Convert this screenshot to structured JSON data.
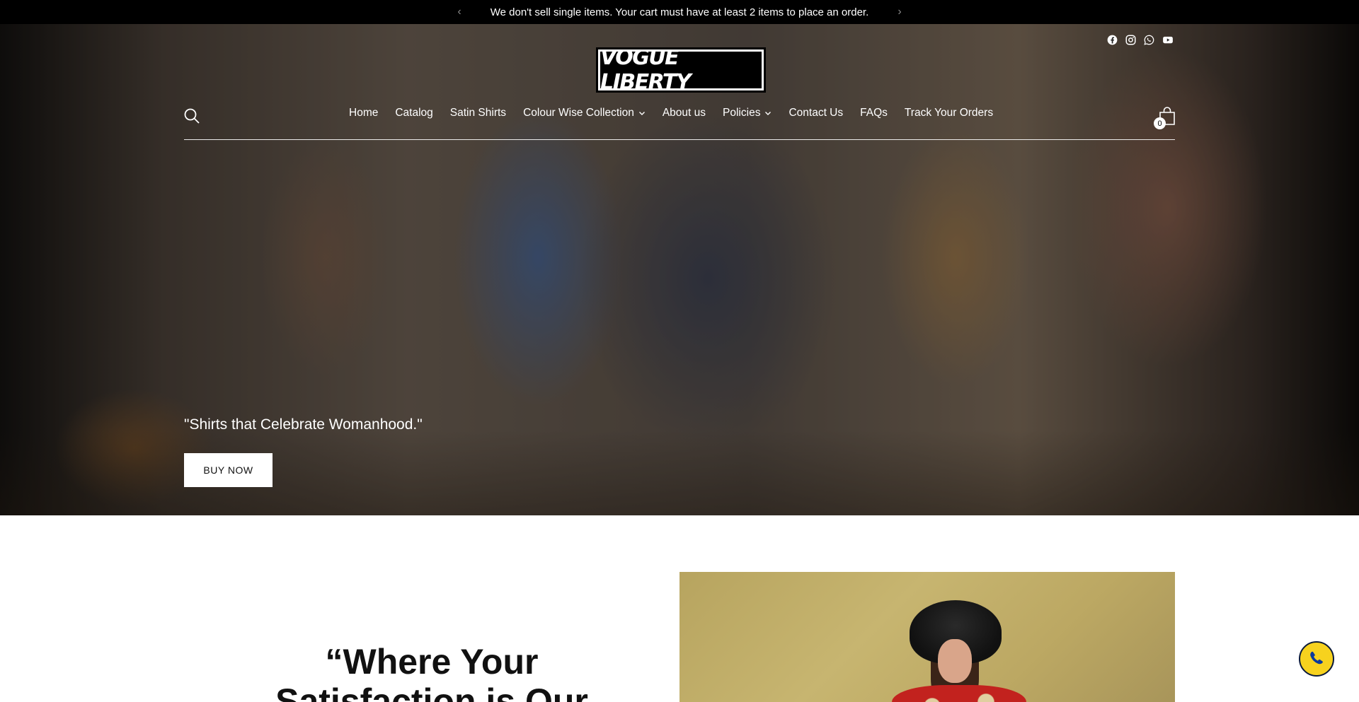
{
  "announcement": {
    "text": "We don't sell single items. Your cart must have at least 2 items to place an order.",
    "prev_icon": "chevron-left-icon",
    "next_icon": "chevron-right-icon"
  },
  "header": {
    "logo_text": "VOGUE LIBERTY",
    "social_icons": [
      "facebook-icon",
      "instagram-icon",
      "whatsapp-icon",
      "youtube-icon"
    ],
    "search_icon": "search-icon",
    "cart_icon": "bag-icon",
    "cart_count": "0",
    "nav": [
      {
        "label": "Home"
      },
      {
        "label": "Catalog"
      },
      {
        "label": "Satin Shirts"
      },
      {
        "label": "Colour Wise Collection",
        "dropdown": true
      },
      {
        "label": "About us"
      },
      {
        "label": "Policies",
        "dropdown": true
      },
      {
        "label": "Contact Us"
      },
      {
        "label": "FAQs"
      },
      {
        "label": "Track Your Orders"
      }
    ]
  },
  "hero": {
    "tagline": "\"Shirts that Celebrate Womanhood.\"",
    "button_label": "BUY NOW"
  },
  "section": {
    "headline": "“Where Your Satisfaction is Our"
  },
  "floating": {
    "whatsapp_icon": "whatsapp-chat-icon"
  },
  "colors": {
    "announcement_bg": "#000000",
    "hero_text": "#ffffff",
    "button_bg": "#ffffff",
    "whatsapp_bg": "#f7d21e"
  }
}
